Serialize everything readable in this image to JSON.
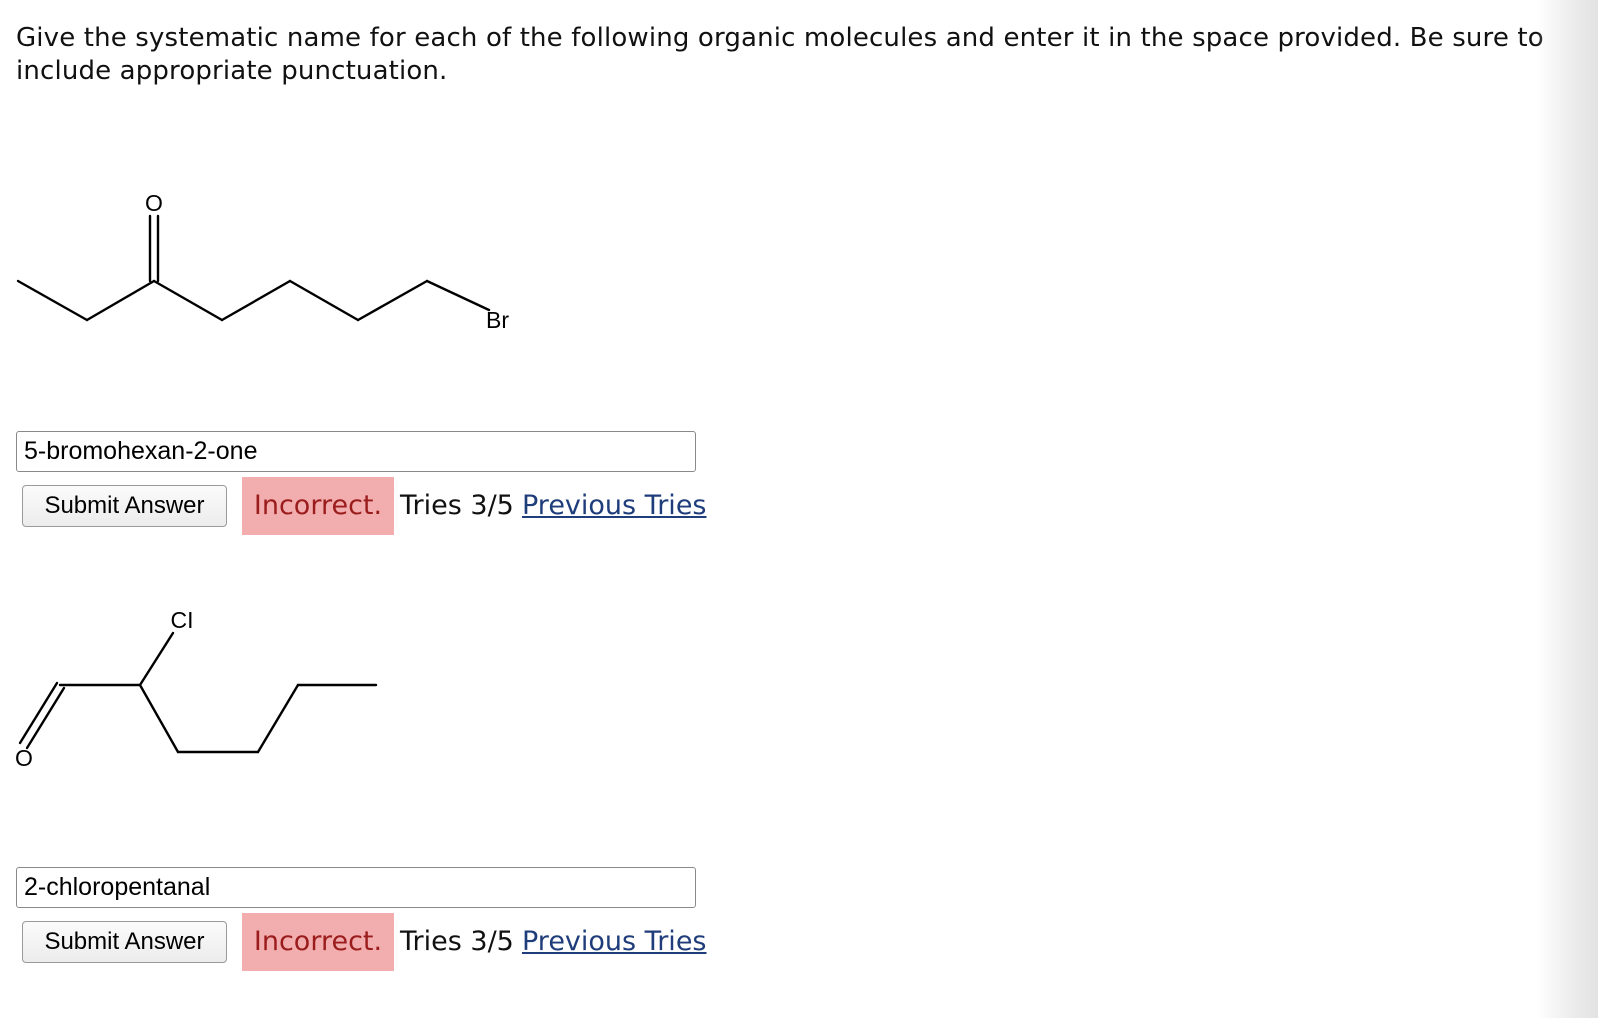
{
  "instructions": "Give the systematic name for each of the following organic molecules and enter it in the space provided. Be sure to include appropriate punctuation.",
  "questions": [
    {
      "structure_atoms": {
        "oxygen": "O",
        "halogen": "Br"
      },
      "answer_value": "5-bromohexan-2-one",
      "submit_label": "Submit Answer",
      "feedback": "Incorrect.",
      "tries": "Tries 3/5",
      "previous_tries_label": "Previous Tries"
    },
    {
      "structure_atoms": {
        "halogen": "CI",
        "oxygen": "O"
      },
      "answer_value": "2-chloropentanal",
      "submit_label": "Submit Answer",
      "feedback": "Incorrect.",
      "tries": "Tries 3/5",
      "previous_tries_label": "Previous Tries"
    }
  ],
  "colors": {
    "incorrect_background": "#f2aeae",
    "incorrect_text": "#9b1c1c",
    "link": "#1f3d7a"
  }
}
